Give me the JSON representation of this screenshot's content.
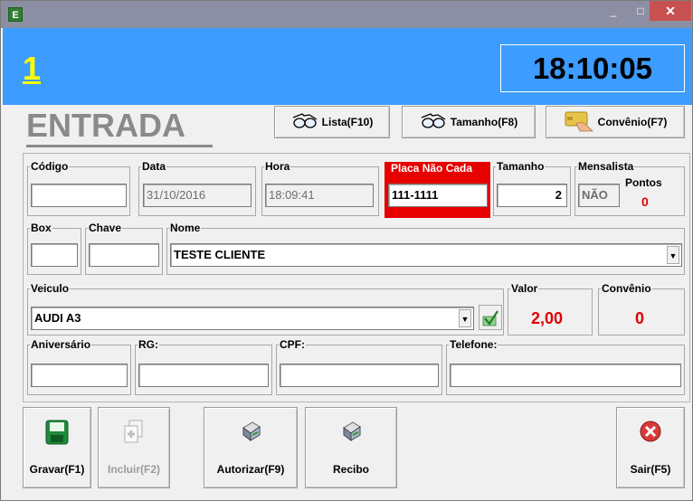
{
  "window": {
    "icon_letter": "E",
    "min_glyph": "_",
    "max_glyph": "□",
    "close_glyph": "✕"
  },
  "header": {
    "ticket_number": "1",
    "clock": "18:10:05"
  },
  "title": "ENTRADA",
  "toolbar": {
    "lista": "Lista(F10)",
    "tamanho": "Tamanho(F8)",
    "convenio": "Convênio(F7)"
  },
  "fields": {
    "codigo": {
      "label": "Código",
      "value": ""
    },
    "data": {
      "label": "Data",
      "value": "31/10/2016"
    },
    "hora": {
      "label": "Hora",
      "value": "18:09:41"
    },
    "placa": {
      "label": "Placa Não Cada",
      "value": "111-1111"
    },
    "tamanho": {
      "label": "Tamanho",
      "value": "2"
    },
    "mensalista": {
      "label": "Mensalista",
      "value": "NÃO",
      "pontos_label": "Pontos",
      "pontos_value": "0"
    },
    "box": {
      "label": "Box",
      "value": ""
    },
    "chave": {
      "label": "Chave",
      "value": ""
    },
    "nome": {
      "label": "Nome",
      "value": "TESTE CLIENTE"
    },
    "veiculo": {
      "label": "Veiculo",
      "value": "AUDI A3"
    },
    "valor": {
      "label": "Valor",
      "value": "2,00"
    },
    "convenio": {
      "label": "Convênio",
      "value": "0"
    },
    "aniversario": {
      "label": "Aniversário",
      "value": ""
    },
    "rg": {
      "label": "RG:",
      "value": ""
    },
    "cpf": {
      "label": "CPF:",
      "value": ""
    },
    "telefone": {
      "label": "Telefone:",
      "value": ""
    }
  },
  "actions": {
    "gravar": "Gravar(F1)",
    "incluir": "Incluir(F2)",
    "autorizar": "Autorizar(F9)",
    "recibo": "Recibo",
    "sair": "Sair(F5)"
  },
  "colors": {
    "accent_blue": "#3c9cff",
    "ticket_yellow": "#ffff00",
    "alert_red": "#e60000"
  }
}
